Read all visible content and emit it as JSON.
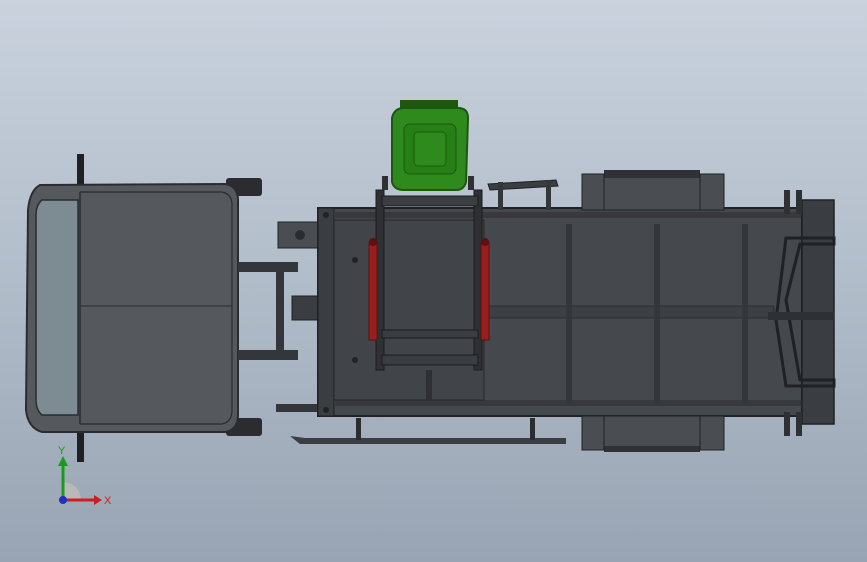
{
  "viewport": {
    "colors": {
      "bg_top": "#c9d2dd",
      "bg_bottom": "#98a4b3"
    }
  },
  "model": {
    "colors": {
      "body_dark": "#3a3d41",
      "body_mid": "#4c5055",
      "cab": "#5a5e63",
      "cab_edge": "#2a2c2f",
      "glass": "#7d8c92",
      "bin_green": "#2f8a1e",
      "bin_dark": "#1d5710",
      "cylinder_red": "#9a1e1e",
      "frame_line": "#1f2124"
    },
    "parts": [
      "cab",
      "windshield",
      "chassis-frame",
      "hopper-body",
      "lifter-arm",
      "waste-bin",
      "hydraulic-cylinder",
      "side-tank",
      "tailgate-frame"
    ]
  },
  "triad": {
    "x_label": "X",
    "y_label": "Y",
    "colors": {
      "x": "#cc1f1f",
      "y": "#1a9a1a",
      "z": "#1f2fbf"
    }
  }
}
